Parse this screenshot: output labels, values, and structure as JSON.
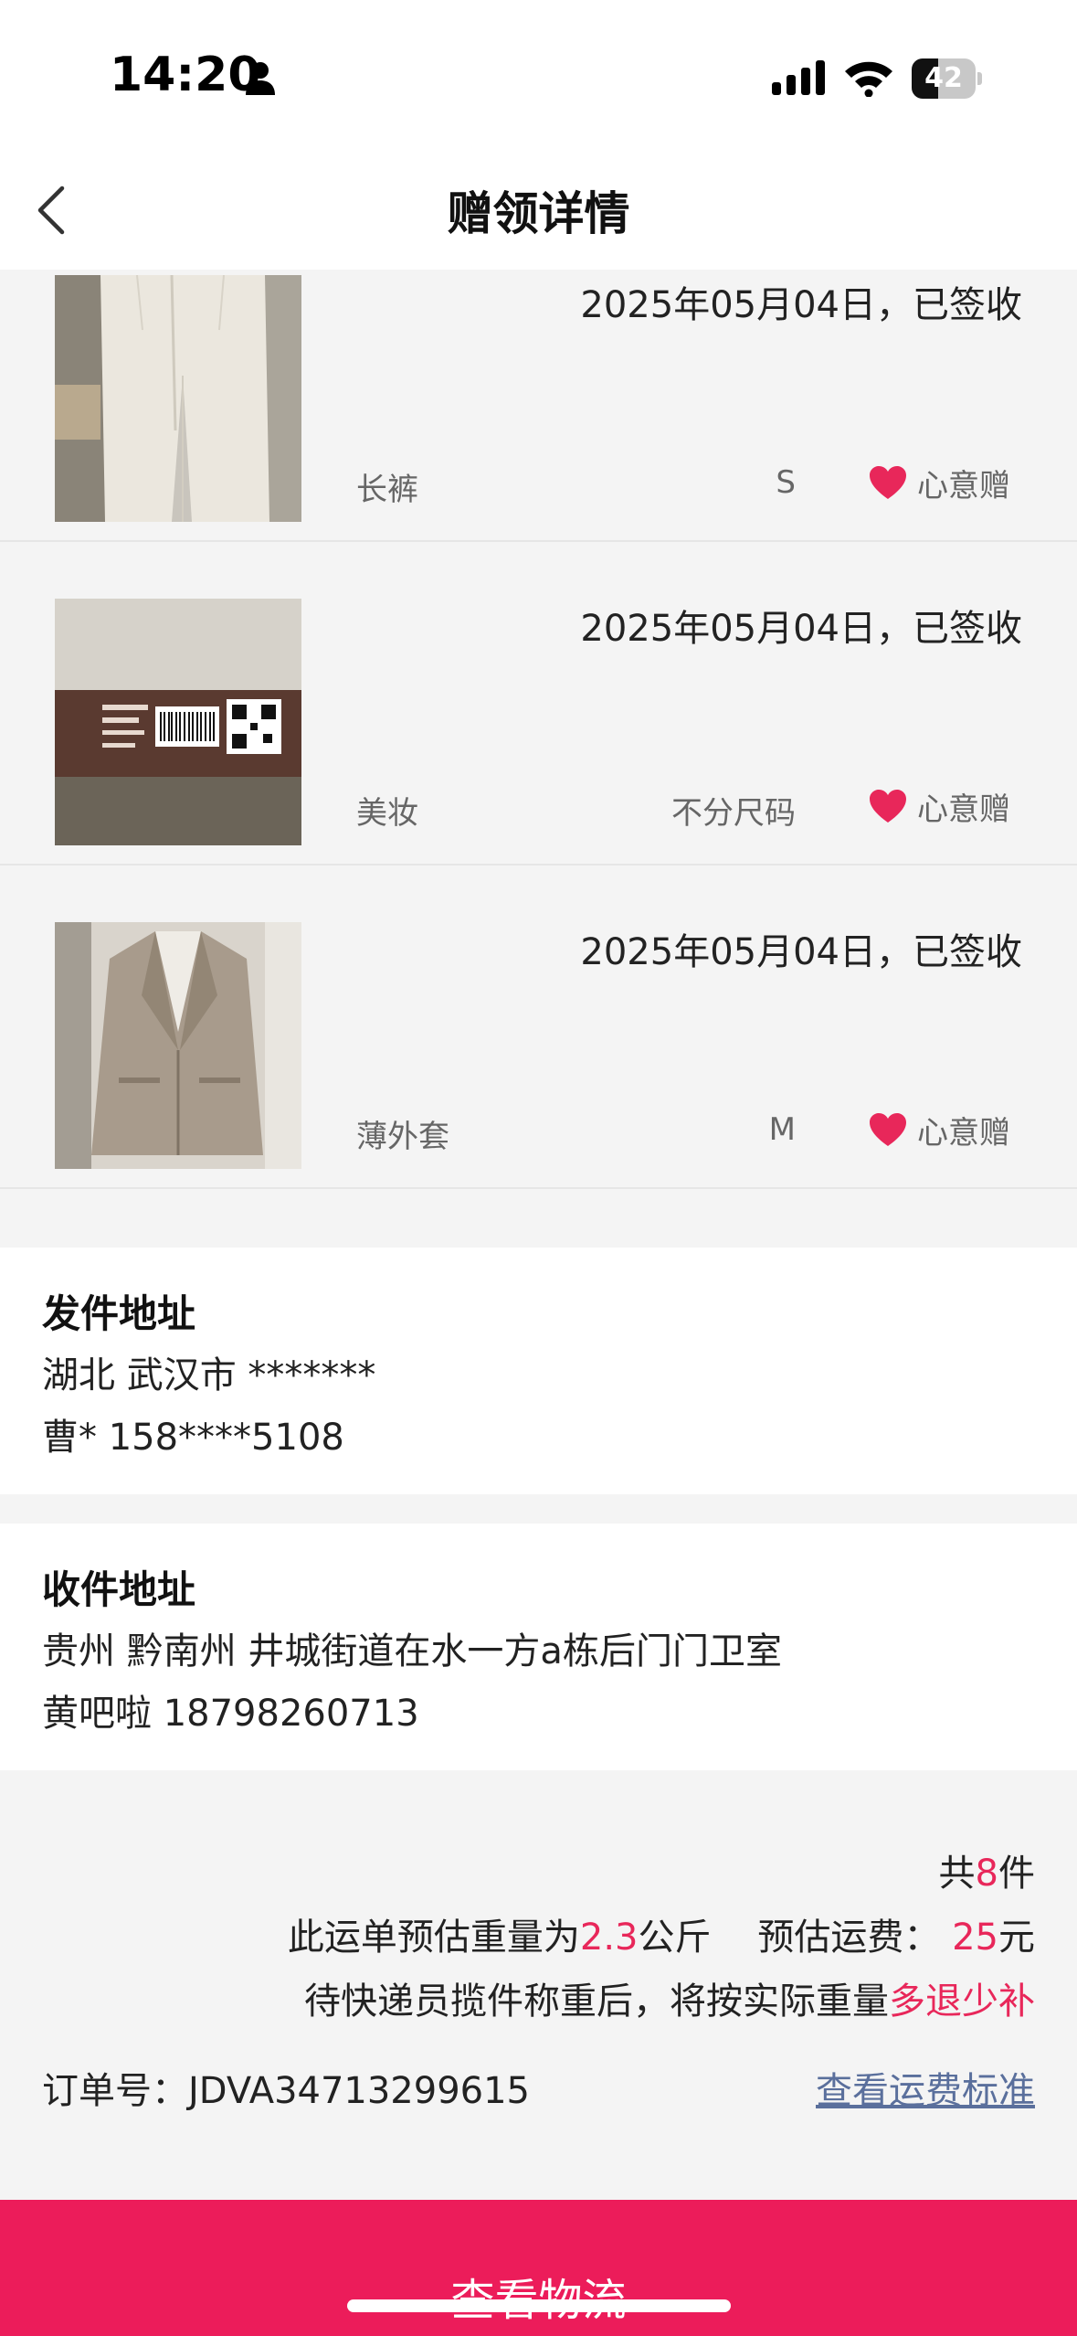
{
  "status_bar": {
    "time": "14:20",
    "battery_level": "42",
    "battery_fraction": 0.42,
    "icons": [
      "person-icon",
      "signal-icon",
      "wifi-icon",
      "battery-icon"
    ]
  },
  "nav": {
    "title": "赠领详情",
    "back_icon": "chevron-left-icon"
  },
  "items": [
    {
      "date": "2025年05月04日，已签收",
      "name": "长裤",
      "size": "S",
      "tag": "心意赠",
      "thumb": "trousers"
    },
    {
      "date": "2025年05月04日，已签收",
      "name": "美妆",
      "size": "不分尺码",
      "tag": "心意赠",
      "thumb": "cosmetics-box"
    },
    {
      "date": "2025年05月04日，已签收",
      "name": "薄外套",
      "size": "M",
      "tag": "心意赠",
      "thumb": "blazer"
    }
  ],
  "sender": {
    "title": "发件地址",
    "region": "湖北 武汉市 *******",
    "contact": "曹* 158****5108"
  },
  "receiver": {
    "title": "收件地址",
    "region": "贵州 黔南州 井城街道在水一方a栋后门门卫室",
    "contact": "黄吧啦 18798260713"
  },
  "summary": {
    "count_prefix": "共",
    "count": "8",
    "count_suffix": "件",
    "weight_prefix": "此运单预估重量为",
    "weight": "2.3",
    "weight_unit": "公斤",
    "fee_prefix": "预估运费：",
    "fee": "25",
    "fee_unit": "元",
    "notice_prefix": "待快递员揽件称重后，将按实际重量",
    "notice_highlight": "多退少补",
    "order_label": "订单号：",
    "order_number": "JDVA34713299615",
    "fee_standard_link": "查看运费标准"
  },
  "footer": {
    "button_label": "查看物流"
  },
  "colors": {
    "accent": "#ec1c5a",
    "highlight": "#e8275a",
    "link": "#5a6f9c",
    "heart": "#e8275a"
  }
}
